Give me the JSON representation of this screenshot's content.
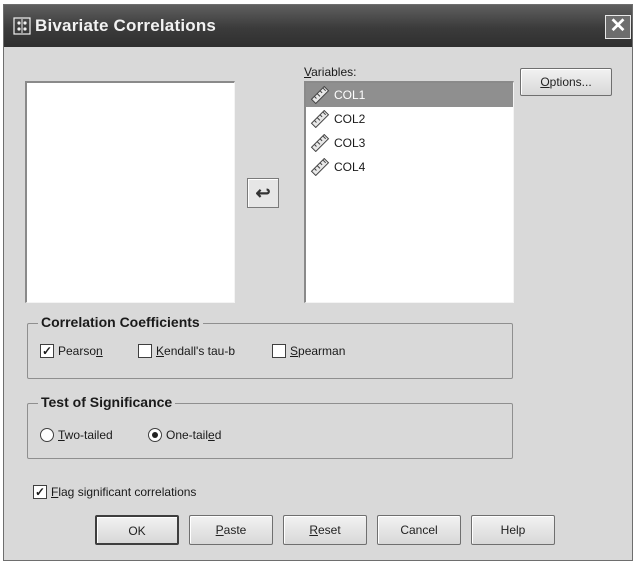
{
  "window": {
    "title": "Bivariate Correlations",
    "close_glyph": "✕"
  },
  "variables": {
    "label": "Variables:",
    "items": [
      "COL1",
      "COL2",
      "COL3",
      "COL4"
    ],
    "selected_index": 0
  },
  "move_button_glyph": "↩",
  "options_label": "Options...",
  "correlation": {
    "title": "Correlation Coefficients",
    "pearson": {
      "label": "Pearson",
      "checked": true
    },
    "kendall": {
      "label": "Kendall's tau-b",
      "checked": false
    },
    "spearman": {
      "label": "Spearman",
      "checked": false
    }
  },
  "significance": {
    "title": "Test of Significance",
    "two_tailed": {
      "label": "Two-tailed",
      "selected": false
    },
    "one_tailed": {
      "label": "One-tailed",
      "selected": true
    }
  },
  "flag": {
    "label": "Flag significant correlations",
    "checked": true
  },
  "buttons": {
    "ok": "OK",
    "paste": "Paste",
    "reset": "Reset",
    "cancel": "Cancel",
    "help": "Help"
  },
  "colors": {
    "dialog_bg": "#d9d9d9",
    "selection": "#8f8f8f",
    "titlebar": "#3b3b3b"
  }
}
